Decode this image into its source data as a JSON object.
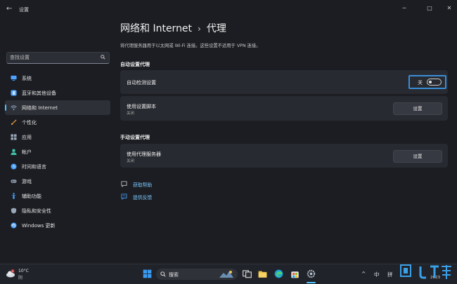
{
  "app": {
    "title": "设置"
  },
  "sidebar": {
    "search_placeholder": "查找设置",
    "items": [
      {
        "label": "系统",
        "icon": "monitor-icon",
        "color": "#4da3ff"
      },
      {
        "label": "蓝牙和其他设备",
        "icon": "bluetooth-icon",
        "color": "#4da3ff"
      },
      {
        "label": "网络和 Internet",
        "icon": "wifi-icon",
        "color": "#9fb7d8",
        "active": true
      },
      {
        "label": "个性化",
        "icon": "brush-icon",
        "color": "#e8a040"
      },
      {
        "label": "应用",
        "icon": "apps-icon",
        "color": "#9aa7b8"
      },
      {
        "label": "帐户",
        "icon": "person-icon",
        "color": "#3fc1a8"
      },
      {
        "label": "时间和语言",
        "icon": "globe-clock-icon",
        "color": "#4da3ff"
      },
      {
        "label": "游戏",
        "icon": "gamepad-icon",
        "color": "#9aa7b8"
      },
      {
        "label": "辅助功能",
        "icon": "accessibility-icon",
        "color": "#4da3ff"
      },
      {
        "label": "隐私和安全性",
        "icon": "shield-icon",
        "color": "#9aa7b8"
      },
      {
        "label": "Windows 更新",
        "icon": "update-icon",
        "color": "#4da3ff"
      }
    ]
  },
  "main": {
    "breadcrumb_parent": "网络和 Internet",
    "breadcrumb_sep": "›",
    "page_title": "代理",
    "description": "将代理服务器用于以太网或 Wi-Fi 连接。这些设置不适用于 VPN 连接。",
    "auto_section_title": "自动设置代理",
    "auto_detect": {
      "title": "自动检测设置",
      "toggle_label": "关",
      "state": "off"
    },
    "setup_script": {
      "title": "使用设置脚本",
      "sub": "关闭",
      "button": "设置"
    },
    "manual_section_title": "手动设置代理",
    "proxy_server": {
      "title": "使用代理服务器",
      "sub": "关闭",
      "button": "设置"
    },
    "links": [
      {
        "label": "获取帮助",
        "icon": "help-chat-icon"
      },
      {
        "label": "提供反馈",
        "icon": "feedback-icon"
      }
    ]
  },
  "taskbar": {
    "weather_temp": "10°C",
    "weather_desc": "阴",
    "weather_badge": "1",
    "search_label": "搜索",
    "tray_lang": "中",
    "tray_ime": "拼",
    "clock_year": "2023"
  },
  "colors": {
    "accent": "#4cc2ff",
    "focus_border": "#3a8ed8",
    "link": "#7cc6ff"
  }
}
